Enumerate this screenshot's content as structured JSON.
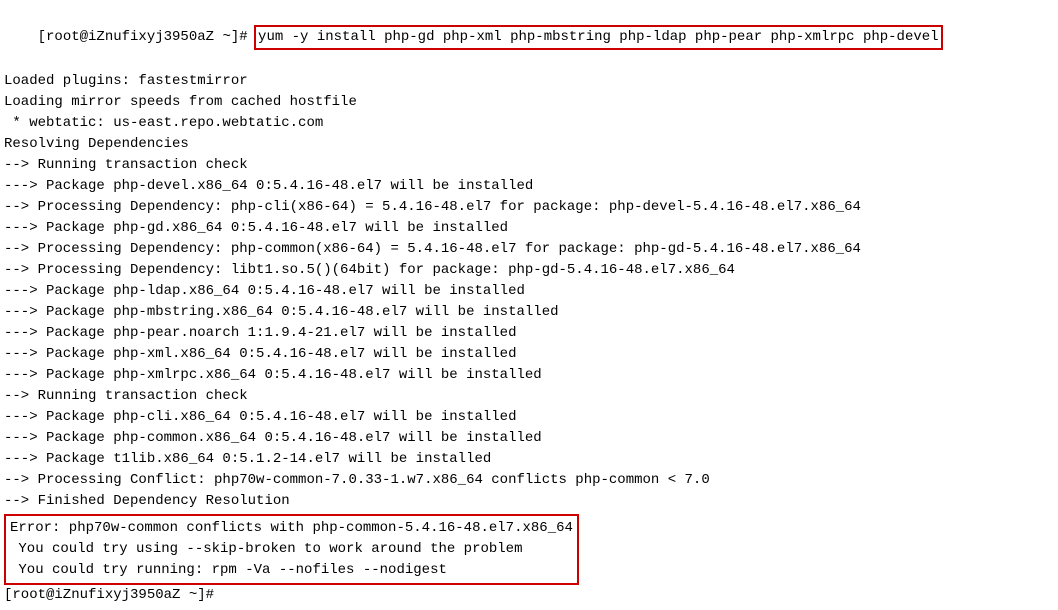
{
  "terminal": {
    "prompt_prefix": "[root@iZnufixyj3950aZ ~]# ",
    "command": "yum -y install php-gd php-xml php-mbstring php-ldap php-pear php-xmlrpc php-devel",
    "lines": [
      "Loaded plugins: fastestmirror",
      "Loading mirror speeds from cached hostfile",
      " * webtatic: us-east.repo.webtatic.com",
      "Resolving Dependencies",
      "--> Running transaction check",
      "---> Package php-devel.x86_64 0:5.4.16-48.el7 will be installed",
      "--> Processing Dependency: php-cli(x86-64) = 5.4.16-48.el7 for package: php-devel-5.4.16-48.el7.x86_64",
      "---> Package php-gd.x86_64 0:5.4.16-48.el7 will be installed",
      "--> Processing Dependency: php-common(x86-64) = 5.4.16-48.el7 for package: php-gd-5.4.16-48.el7.x86_64",
      "--> Processing Dependency: libt1.so.5()(64bit) for package: php-gd-5.4.16-48.el7.x86_64",
      "---> Package php-ldap.x86_64 0:5.4.16-48.el7 will be installed",
      "---> Package php-mbstring.x86_64 0:5.4.16-48.el7 will be installed",
      "---> Package php-pear.noarch 1:1.9.4-21.el7 will be installed",
      "---> Package php-xml.x86_64 0:5.4.16-48.el7 will be installed",
      "---> Package php-xmlrpc.x86_64 0:5.4.16-48.el7 will be installed",
      "--> Running transaction check",
      "---> Package php-cli.x86_64 0:5.4.16-48.el7 will be installed",
      "---> Package php-common.x86_64 0:5.4.16-48.el7 will be installed",
      "---> Package t1lib.x86_64 0:5.1.2-14.el7 will be installed",
      "--> Processing Conflict: php70w-common-7.0.33-1.w7.x86_64 conflicts php-common < 7.0",
      "--> Finished Dependency Resolution"
    ],
    "error_lines": [
      "Error: php70w-common conflicts with php-common-5.4.16-48.el7.x86_64",
      " You could try using --skip-broken to work around the problem",
      " You could try running: rpm -Va --nofiles --nodigest"
    ],
    "next_prompt": "[root@iZnufixyj3950aZ ~]# "
  }
}
